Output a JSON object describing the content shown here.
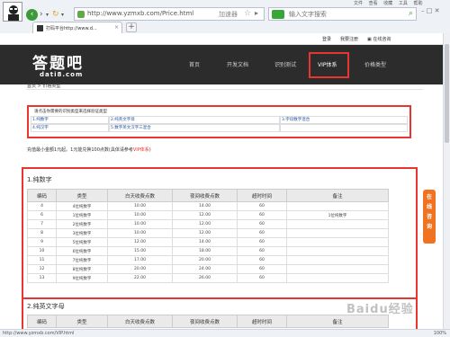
{
  "browser": {
    "url": "http://www.yzmxb.com/Price.html",
    "speed_label": "加速器",
    "search_placeholder": "输入文字搜索",
    "menu": [
      "文件",
      "查看",
      "收藏",
      "工具",
      "帮助"
    ],
    "tab_title": "打码平台http://www.d...",
    "status_url": "http://www.yzmxb.com/VIP.html"
  },
  "topbar": {
    "login": "登录",
    "register": "我要注册",
    "online": "在线咨询"
  },
  "site": {
    "logo_cn": "答题吧",
    "logo_en": "dati8.com",
    "nav": [
      "首页",
      "开发文档",
      "识别测试",
      "VIP体系",
      "价格类型"
    ],
    "breadcrumb": "首页 > 价格类型"
  },
  "selector": {
    "heading": "请点击你需要的识别类型来选择验证类型",
    "items": [
      "1.纯数字",
      "2.纯英文字母",
      "3.字母数字混合",
      "4.纯汉字",
      "5.数字英文汉字三混合"
    ]
  },
  "note": {
    "text": "充值最小金额1元起。1元能兑换100点数(具体请参考",
    "link": "VIP体系",
    "close": ")"
  },
  "table1": {
    "title": "1.纯数字",
    "headers": [
      "编码",
      "类型",
      "白天收费点数",
      "夜间收费点数",
      "超时时间",
      "备注"
    ],
    "rows": [
      [
        "4",
        "4位纯数字",
        "10.00",
        "14.00",
        "60",
        ""
      ],
      [
        "6",
        "1位纯数字",
        "10.00",
        "12.00",
        "60",
        "1位纯数字"
      ],
      [
        "7",
        "2位纯数字",
        "10.00",
        "12.00",
        "60",
        ""
      ],
      [
        "8",
        "3位纯数字",
        "10.00",
        "12.00",
        "60",
        ""
      ],
      [
        "9",
        "5位纯数字",
        "12.00",
        "14.00",
        "60",
        ""
      ],
      [
        "10",
        "6位纯数字",
        "15.00",
        "18.00",
        "60",
        ""
      ],
      [
        "11",
        "7位纯数字",
        "17.00",
        "20.00",
        "60",
        ""
      ],
      [
        "12",
        "8位纯数字",
        "20.00",
        "24.00",
        "60",
        ""
      ],
      [
        "13",
        "9位纯数字",
        "22.00",
        "26.00",
        "60",
        ""
      ]
    ]
  },
  "table2": {
    "title": "2.纯英文字母",
    "headers": [
      "编码",
      "类型",
      "白天收费点数",
      "夜间收费点数",
      "超时时间",
      "备注"
    ]
  },
  "online_btn": [
    "在",
    "线",
    "咨",
    "询"
  ],
  "zoom": "100%",
  "watermark": "Baidu经验"
}
